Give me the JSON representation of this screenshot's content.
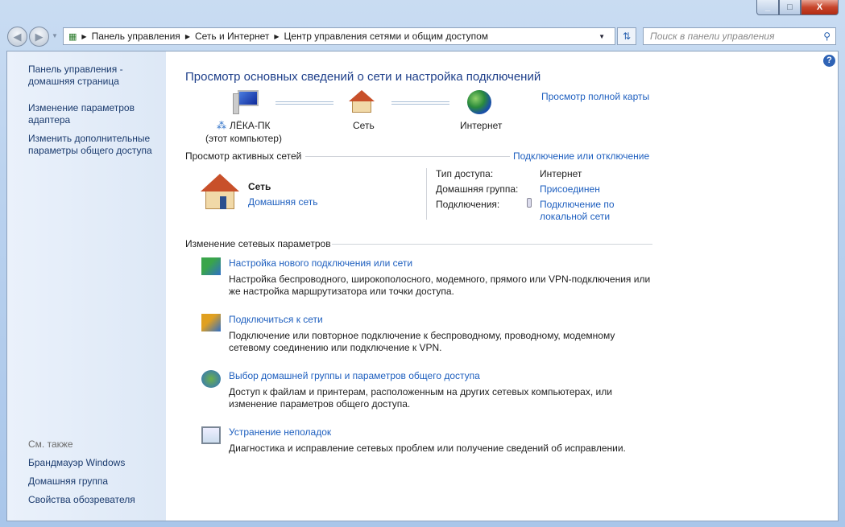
{
  "window": {
    "minimize": "_",
    "maximize": "□",
    "close": "X"
  },
  "breadcrumb": [
    "Панель управления",
    "Сеть и Интернет",
    "Центр управления сетями и общим доступом"
  ],
  "search": {
    "placeholder": "Поиск в панели управления"
  },
  "sidebar": {
    "items": [
      "Панель управления - домашняя страница",
      "Изменение параметров адаптера",
      "Изменить дополнительные параметры общего доступа"
    ],
    "see_also": "См. также",
    "see_also_items": [
      "Брандмауэр Windows",
      "Домашняя группа",
      "Свойства обозревателя"
    ]
  },
  "main": {
    "title": "Просмотр основных сведений о сети и настройка подключений",
    "full_map": "Просмотр полной карты",
    "map": {
      "computer": "ЛЁКА-ПК",
      "computer_sub": "(этот компьютер)",
      "network": "Сеть",
      "internet": "Интернет"
    },
    "active_title": "Просмотр активных сетей",
    "connect_link": "Подключение или отключение",
    "net_name": "Сеть",
    "net_type": "Домашняя сеть",
    "access_label": "Тип доступа:",
    "access_value": "Интернет",
    "homegroup_label": "Домашняя группа:",
    "homegroup_value": "Присоединен",
    "conn_label": "Подключения:",
    "conn_value": "Подключение по локальной сети",
    "change_title": "Изменение сетевых параметров",
    "tasks": [
      {
        "title": "Настройка нового подключения или сети",
        "desc": "Настройка беспроводного, широкополосного, модемного, прямого или VPN-подключения или же настройка маршрутизатора или точки доступа."
      },
      {
        "title": "Подключиться к сети",
        "desc": "Подключение или повторное подключение к беспроводному, проводному, модемному сетевому соединению или подключение к VPN."
      },
      {
        "title": "Выбор домашней группы и параметров общего доступа",
        "desc": "Доступ к файлам и принтерам, расположенным на других сетевых компьютерах, или изменение параметров общего доступа."
      },
      {
        "title": "Устранение неполадок",
        "desc": "Диагностика и исправление сетевых проблем или получение сведений об исправлении."
      }
    ],
    "help": "?"
  }
}
